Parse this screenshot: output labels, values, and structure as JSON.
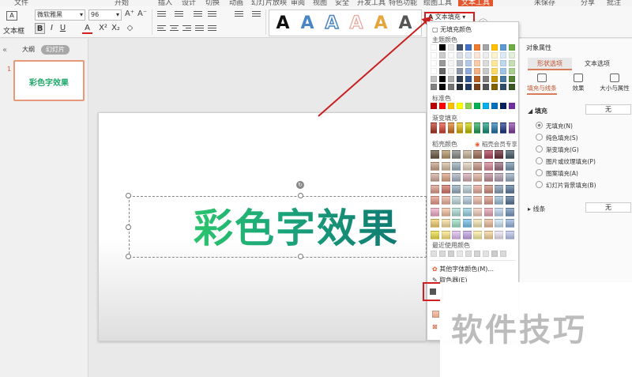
{
  "ribbon": {
    "menu_items": [
      "文件",
      "开始",
      "插入",
      "设计",
      "切换",
      "动画",
      "幻灯片放映",
      "审阅",
      "视图",
      "安全",
      "开发工具",
      "特色功能",
      "绘图工具",
      "文本工具"
    ],
    "top_right": [
      "未保存",
      "分享",
      "批注"
    ],
    "textbox_label": "文本框",
    "font_name": "微软雅黑",
    "font_size": "96",
    "format_buttons": [
      "B",
      "I",
      "U",
      "A",
      "X²",
      "X₂"
    ],
    "text_fill_label": "文本填充",
    "style_glyph": "A",
    "style_colors": [
      "#111111",
      "#4a86c5",
      "#7fb3de",
      "#f0c9c0",
      "#e6a43b",
      "#555555"
    ]
  },
  "left_panel": {
    "tabs": [
      "大纲",
      "幻灯片"
    ],
    "slide_number": "1",
    "thumb_text": "彩色字效果"
  },
  "slide": {
    "title_text": "彩色字效果"
  },
  "dropdown": {
    "no_fill": "无填充颜色",
    "theme_colors_label": "主题颜色",
    "standard_label": "标准色",
    "gradient_label": "渐变填充",
    "texture_label": "稻壳颜色",
    "vip_label": "稻壳会员专享",
    "recent_label": "最近使用颜色",
    "more_colors": "其他字体颜色(M)...",
    "eyedropper": "取色器(E)",
    "theme_top": [
      "#ffffff",
      "#000000",
      "#e7e6e6",
      "#44546a",
      "#4472c4",
      "#ed7d31",
      "#a5a5a5",
      "#ffc000",
      "#5b9bd5",
      "#70ad47"
    ],
    "standard": [
      "#c00000",
      "#ff0000",
      "#ffc000",
      "#ffff00",
      "#92d050",
      "#00b050",
      "#00b0f0",
      "#0070c0",
      "#002060",
      "#7030a0"
    ],
    "gradient": [
      "#c0392b",
      "#e74c3c",
      "#e67e22",
      "#f1c40f",
      "#d4d800",
      "#27ae60",
      "#16a085",
      "#2980b9",
      "#1f3a93",
      "#8e44ad"
    ]
  },
  "right_pane": {
    "title": "对象属性",
    "tabs": [
      "形状选项",
      "文本选项"
    ],
    "subtabs": [
      "填充与线条",
      "效果",
      "大小与属性"
    ],
    "fill_label": "填充",
    "fill_value": "无",
    "fill_options": [
      "无填充(N)",
      "纯色填充(S)",
      "渐变填充(G)",
      "图片或纹理填充(P)",
      "图案填充(A)",
      "幻灯片背景填充(B)"
    ],
    "line_label": "线条",
    "line_value": "无"
  },
  "watermark": {
    "text": "软件技巧"
  }
}
